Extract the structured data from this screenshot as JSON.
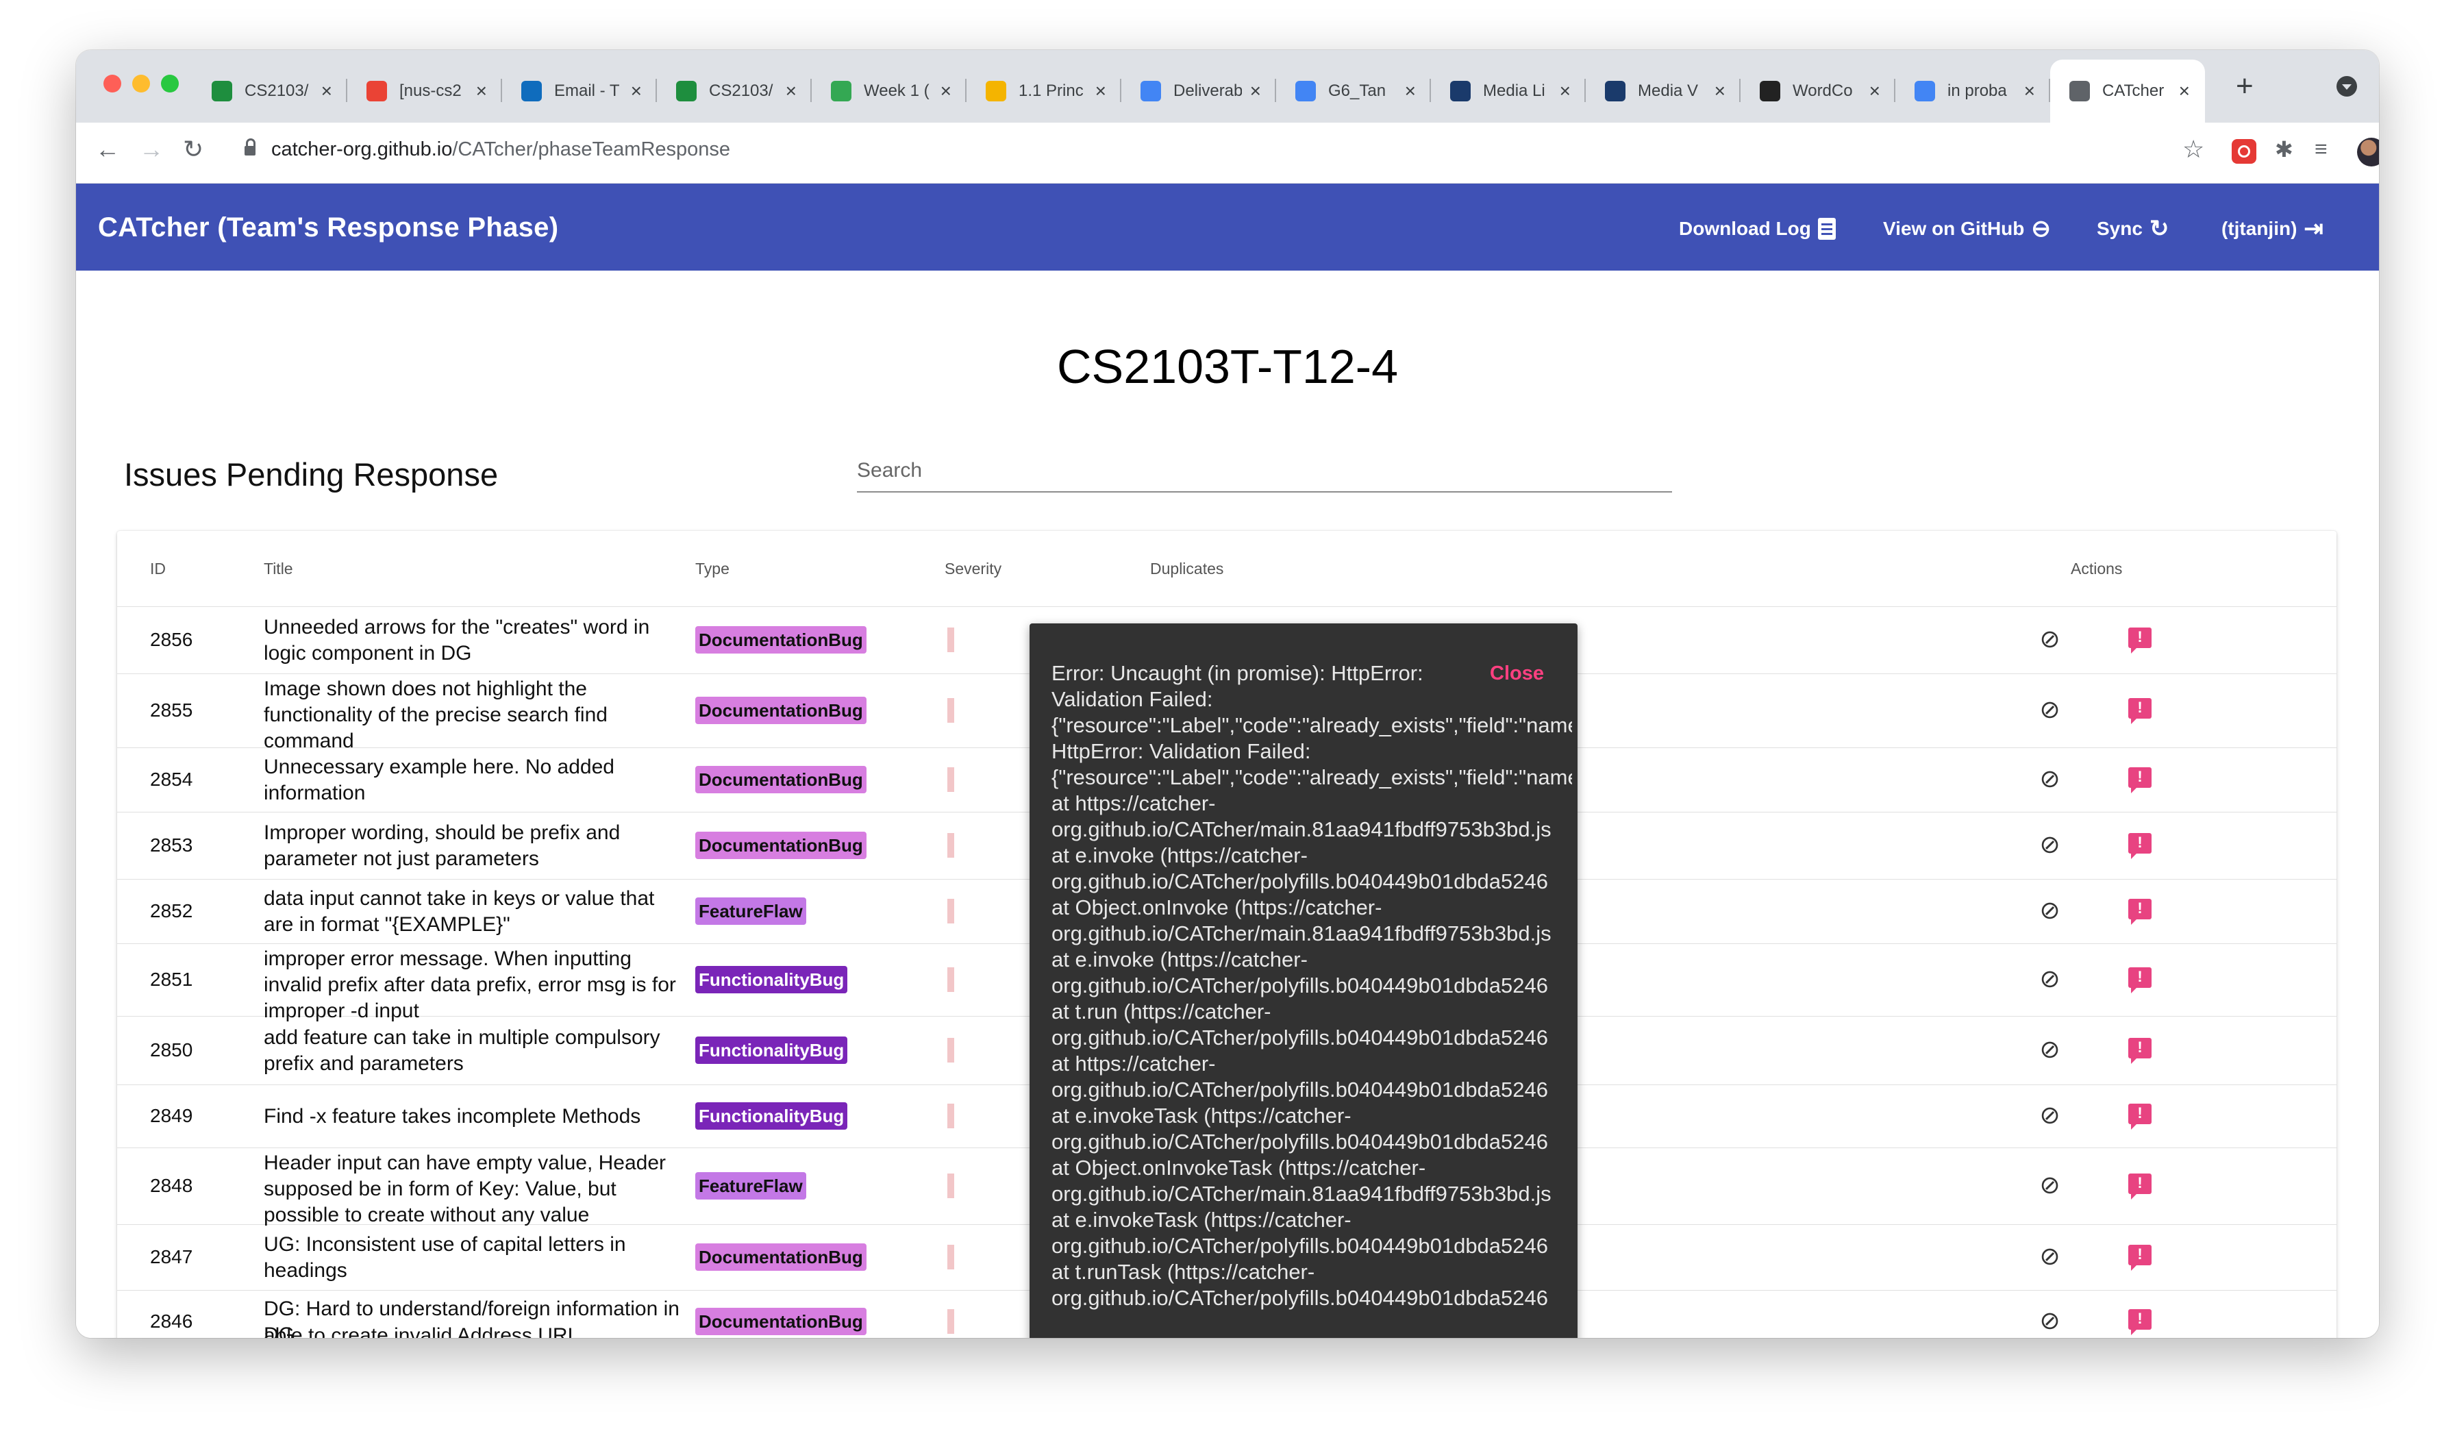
{
  "browser": {
    "tabs": [
      {
        "title": "CS2103/",
        "favicon": "graduation-cap-icon",
        "color": "#1e8e3e"
      },
      {
        "title": "[nus-cs2",
        "favicon": "gmail-icon",
        "color": "#ea4335"
      },
      {
        "title": "Email - T",
        "favicon": "outlook-icon",
        "color": "#0f6cbd"
      },
      {
        "title": "CS2103/",
        "favicon": "graduation-cap-icon",
        "color": "#1e8e3e"
      },
      {
        "title": "Week 1 (",
        "favicon": "google-drive-icon",
        "color": "#34a853"
      },
      {
        "title": "1.1 Princ",
        "favicon": "google-slides-icon",
        "color": "#f4b400"
      },
      {
        "title": "Deliverab",
        "favicon": "google-docs-icon",
        "color": "#4285f4"
      },
      {
        "title": "G6_Tan",
        "favicon": "google-docs-icon",
        "color": "#4285f4"
      },
      {
        "title": "Media Li",
        "favicon": "media-icon",
        "color": "#1a3a6b"
      },
      {
        "title": "Media V",
        "favicon": "media-icon",
        "color": "#1a3a6b"
      },
      {
        "title": "WordCo",
        "favicon": "wordcounter-icon",
        "color": "#222222"
      },
      {
        "title": "in proba",
        "favicon": "google-icon",
        "color": "#4285f4"
      },
      {
        "title": "CATcher",
        "favicon": "catcher-icon",
        "color": "#5f6368"
      }
    ],
    "url_host": "catcher-org.github.io",
    "url_path": "/CATcher/phaseTeamResponse"
  },
  "header": {
    "title": "CATcher  (Team's Response Phase)",
    "download_log": "Download Log",
    "view_github": "View on GitHub",
    "sync": "Sync",
    "user": "(tjtanjin)"
  },
  "main": {
    "team": "CS2103T-T12-4",
    "section_title": "Issues Pending Response",
    "search_placeholder": "Search"
  },
  "table": {
    "columns": {
      "id": "ID",
      "title": "Title",
      "type": "Type",
      "severity": "Severity",
      "duplicates": "Duplicates",
      "actions": "Actions"
    },
    "rows": [
      {
        "id": "2856",
        "title": "Unneeded arrows for the \"creates\" word in logic component in DG",
        "type": "DocumentationBug"
      },
      {
        "id": "2855",
        "title": "Image shown does not highlight the functionality of the precise search find command",
        "type": "DocumentationBug"
      },
      {
        "id": "2854",
        "title": "Unnecessary example here. No added information",
        "type": "DocumentationBug"
      },
      {
        "id": "2853",
        "title": "Improper wording, should be prefix and parameter not just parameters",
        "type": "DocumentationBug"
      },
      {
        "id": "2852",
        "title": "data input cannot take in keys or value that are in format \"{EXAMPLE}\"",
        "type": "FeatureFlaw"
      },
      {
        "id": "2851",
        "title": "improper error message. When inputting invalid prefix after data prefix, error msg is for improper -d input",
        "type": "FunctionalityBug"
      },
      {
        "id": "2850",
        "title": "add feature can take in multiple compulsory prefix and parameters",
        "type": "FunctionalityBug"
      },
      {
        "id": "2849",
        "title": "Find -x feature takes incomplete Methods",
        "type": "FunctionalityBug"
      },
      {
        "id": "2848",
        "title": "Header input can have empty value, Header supposed be in form of Key: Value, but possible to create without any value",
        "type": "FeatureFlaw"
      },
      {
        "id": "2847",
        "title": "UG: Inconsistent use of capital letters in headings",
        "type": "DocumentationBug"
      },
      {
        "id": "2846",
        "title": "DG: Hard to understand/foreign information in DG",
        "type": "DocumentationBug"
      }
    ],
    "partial_row": "able to create invalid Address URL"
  },
  "snackbar": {
    "message": "Error: Uncaught (in promise): HttpError:\nValidation Failed:\n{\"resource\":\"Label\",\"code\":\"already_exists\",\"field\":\"name\nHttpError: Validation Failed:\n{\"resource\":\"Label\",\"code\":\"already_exists\",\"field\":\"name\nat https://catcher-\norg.github.io/CATcher/main.81aa941fbdff9753b3bd.js\nat e.invoke (https://catcher-\norg.github.io/CATcher/polyfills.b040449b01dbda5246\nat Object.onInvoke (https://catcher-\norg.github.io/CATcher/main.81aa941fbdff9753b3bd.js\nat e.invoke (https://catcher-\norg.github.io/CATcher/polyfills.b040449b01dbda5246\nat t.run (https://catcher-\norg.github.io/CATcher/polyfills.b040449b01dbda5246\nat https://catcher-\norg.github.io/CATcher/polyfills.b040449b01dbda5246\nat e.invokeTask (https://catcher-\norg.github.io/CATcher/polyfills.b040449b01dbda5246\nat Object.onInvokeTask (https://catcher-\norg.github.io/CATcher/main.81aa941fbdff9753b3bd.js\nat e.invokeTask (https://catcher-\norg.github.io/CATcher/polyfills.b040449b01dbda5246\nat t.runTask (https://catcher-\norg.github.io/CATcher/polyfills.b040449b01dbda5246",
    "close": "Close"
  },
  "colors": {
    "appbar": "#3f51b5",
    "accent": "#ff4081",
    "documentation_bug": "#d77ee0",
    "feature_flaw": "#c378e6",
    "functionality_bug": "#7a25b8",
    "response_icon": "#e84381"
  }
}
